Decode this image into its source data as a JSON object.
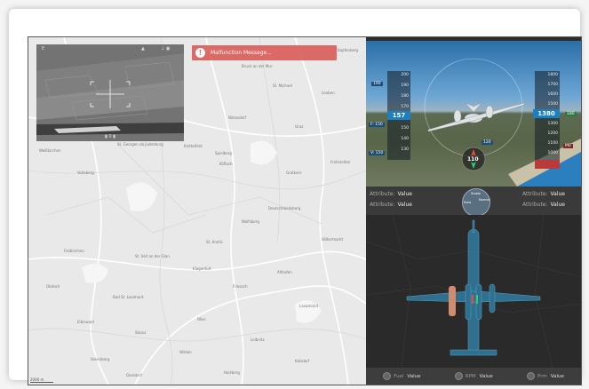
{
  "malfunction": {
    "message": "Malfunction Message..."
  },
  "camera": {
    "top_left": "E",
    "top_center": "▲",
    "top_right": "⇣ ▣",
    "bottom": "▮ 0 ▮"
  },
  "map": {
    "places": [
      "Kapfenberg",
      "Bruck an der Mur",
      "St. Michael",
      "Leoben",
      "Niklasdorf",
      "Graz",
      "St. Georgen ob Judenburg",
      "Knittelfeld",
      "Spielberg",
      "Weißkirchen",
      "Gratkorn",
      "Voitsberg",
      "Köflach",
      "Frohnleiten",
      "Deutschlandsberg",
      "Wolfsberg",
      "St. Andrä",
      "Völkermarkt",
      "St. Veit an der Glan",
      "Feldkirchen",
      "Klagenfurt",
      "Althofen",
      "Friesach",
      "Obdach",
      "Bad St. Leonhard",
      "Lavamünd",
      "Eibiswald",
      "Wies",
      "Stainz",
      "Leibnitz",
      "Wildon",
      "Seiersberg",
      "Kalsdorf",
      "Hartberg",
      "Gleisdorf"
    ],
    "scale": "2000 m"
  },
  "pfd": {
    "speed_ticks": [
      "200",
      "190",
      "180",
      "170",
      "160",
      "150",
      "140",
      "130",
      "120"
    ],
    "speed_value": "157",
    "speed_tag_top": "190",
    "speed_tag_mid": "F: 150",
    "speed_tag_bottom": "V: 150",
    "alt_ticks": [
      "1800",
      "1700",
      "1600",
      "1500",
      "1400",
      "1300",
      "1200",
      "1100",
      "1000",
      "900"
    ],
    "alt_value": "1380",
    "alt_tag_top": "180",
    "alt_tag_bottom": "M0",
    "heading_value": "110",
    "heading_tag": "120"
  },
  "attributes": {
    "left1": {
      "label": "Attribute:",
      "value": "Value"
    },
    "left2": {
      "label": "Attribute:",
      "value": "Value"
    },
    "right1": {
      "label": "Attribute:",
      "value": "Value"
    },
    "right2": {
      "label": "Attribute:",
      "value": "Value"
    },
    "dial": [
      "Slow",
      "Stable",
      "Normal"
    ]
  },
  "stats": [
    {
      "label": "Fuel",
      "value": "Value"
    },
    {
      "label": "RPM",
      "value": "Value"
    },
    {
      "label": "Prm",
      "value": "Value"
    }
  ],
  "colors": {
    "malfunction": "#d9534f",
    "readout": "#1c7fc1",
    "aircraft": "#2f6f8f"
  }
}
